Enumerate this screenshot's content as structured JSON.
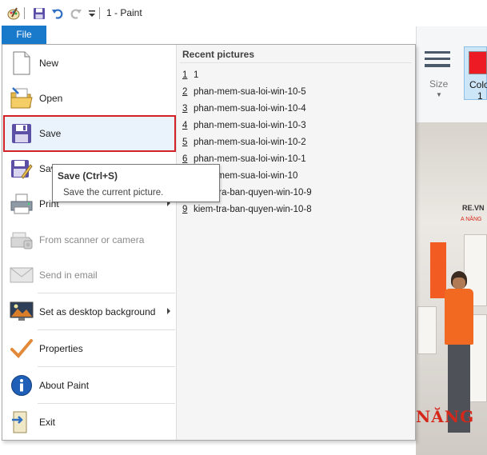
{
  "window": {
    "title": "1 - Paint"
  },
  "quick_access": {
    "icons": [
      "paint-app-icon",
      "save-icon",
      "undo-icon",
      "redo-icon",
      "customize-dropdown-icon"
    ]
  },
  "ribbon": {
    "size_label": "Size",
    "color_label_line1": "Colo",
    "color_label_line2": "1",
    "color1_value": "#ed1c24"
  },
  "file_tab": {
    "label": "File"
  },
  "file_menu": {
    "items": [
      {
        "label": "New",
        "icon": "new-file-icon",
        "disabled": false,
        "submenu": false
      },
      {
        "label": "Open",
        "icon": "open-folder-icon",
        "disabled": false,
        "submenu": false
      },
      {
        "label": "Save",
        "icon": "save-floppy-icon",
        "disabled": false,
        "submenu": false,
        "highlighted": true
      },
      {
        "label": "Save as",
        "icon": "save-as-icon",
        "disabled": false,
        "submenu": true
      },
      {
        "label": "Print",
        "icon": "printer-icon",
        "disabled": false,
        "submenu": true
      },
      {
        "label": "From scanner or camera",
        "icon": "scanner-icon",
        "disabled": true,
        "submenu": false
      },
      {
        "label": "Send in email",
        "icon": "email-icon",
        "disabled": true,
        "submenu": false
      },
      {
        "label": "Set as desktop background",
        "icon": "desktop-background-icon",
        "disabled": false,
        "submenu": true
      },
      {
        "label": "Properties",
        "icon": "checkmark-icon",
        "disabled": false,
        "submenu": false
      },
      {
        "label": "About Paint",
        "icon": "info-icon",
        "disabled": false,
        "submenu": false
      },
      {
        "label": "Exit",
        "icon": "exit-icon",
        "disabled": false,
        "submenu": false
      }
    ]
  },
  "recent": {
    "title": "Recent pictures",
    "items": [
      {
        "num": "1",
        "name": "1"
      },
      {
        "num": "2",
        "name": "phan-mem-sua-loi-win-10-5"
      },
      {
        "num": "3",
        "name": "phan-mem-sua-loi-win-10-4"
      },
      {
        "num": "4",
        "name": "phan-mem-sua-loi-win-10-3"
      },
      {
        "num": "5",
        "name": "phan-mem-sua-loi-win-10-2"
      },
      {
        "num": "6",
        "name": "phan-mem-sua-loi-win-10-1"
      },
      {
        "num": "7",
        "name": "phan-mem-sua-loi-win-10"
      },
      {
        "num": "8",
        "name": "kiem-tra-ban-quyen-win-10-9"
      },
      {
        "num": "9",
        "name": "kiem-tra-ban-quyen-win-10-8"
      }
    ]
  },
  "tooltip": {
    "title": "Save (Ctrl+S)",
    "description": "Save the current picture."
  },
  "canvas_text": {
    "brand": "NĂNG",
    "vn": "RE.VN",
    "sub": "A NĂNG"
  }
}
